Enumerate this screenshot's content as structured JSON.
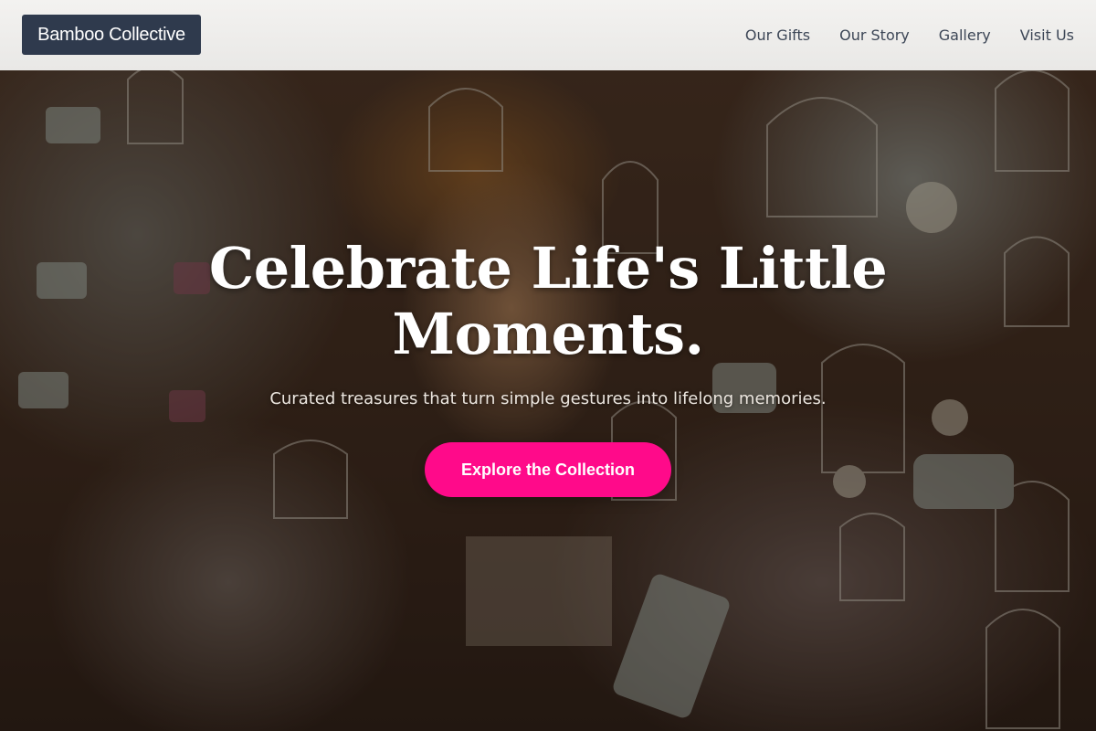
{
  "header": {
    "brand": "Bamboo Collective",
    "nav": [
      {
        "label": "Our Gifts"
      },
      {
        "label": "Our Story"
      },
      {
        "label": "Gallery"
      },
      {
        "label": "Visit Us"
      }
    ]
  },
  "hero": {
    "headline": "Celebrate Life's Little Moments.",
    "subheadline": "Curated treasures that turn simple gestures into lifelong memories.",
    "cta_label": "Explore the Collection",
    "background_image": "shop-interior-with-birdcages-watering-cans-and-flowers"
  },
  "colors": {
    "brand_badge": "#2f3a4d",
    "cta": "#ff0a8a",
    "nav_text": "#3c4656"
  }
}
